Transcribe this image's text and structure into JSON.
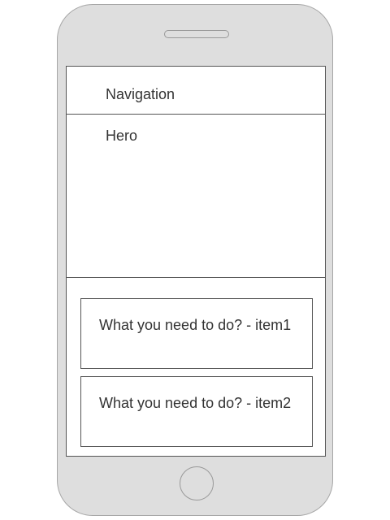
{
  "navigation": {
    "label": "Navigation"
  },
  "hero": {
    "label": "Hero"
  },
  "items": [
    {
      "label": "What you need to do? - item1"
    },
    {
      "label": "What you need to do? - item2"
    }
  ],
  "colors": {
    "device_body": "#dedede",
    "device_outline": "#a6a6a6",
    "screen_background": "#ffffff",
    "border": "#555555",
    "text": "#333333"
  }
}
